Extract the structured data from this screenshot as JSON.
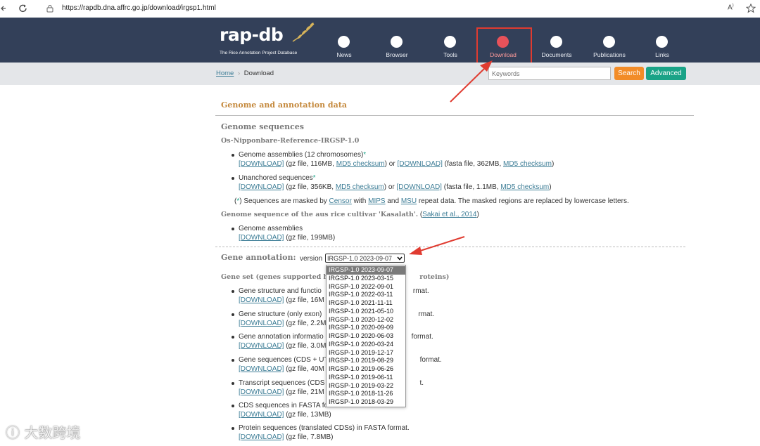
{
  "browser": {
    "url": "https://rapdb.dna.affrc.go.jp/download/irgsp1.html"
  },
  "brand": {
    "logo": "rap-db",
    "tagline": "The Rice Annotation Project Database"
  },
  "nav": [
    {
      "label": "News"
    },
    {
      "label": "Browser"
    },
    {
      "label": "Tools"
    },
    {
      "label": "Download"
    },
    {
      "label": "Documents"
    },
    {
      "label": "Publications"
    },
    {
      "label": "Links"
    }
  ],
  "breadcrumb": {
    "home": "Home",
    "sep": "›",
    "current": "Download"
  },
  "search": {
    "placeholder": "Keywords",
    "search_label": "Search",
    "advanced_label": "Advanced"
  },
  "colors": {
    "header": "#334059",
    "search": "#f28c28",
    "advanced": "#1aa387",
    "highlight": "#e03b30",
    "accent": "#c58a3e"
  },
  "content": {
    "section_title": "Genome and annotation data",
    "genome_seq_title": "Genome sequences",
    "ref_title": "Os-Nipponbare-Reference-IRGSP-1.0",
    "asm_label": "Genome assemblies (12 chromosomes)",
    "asm_star": "*",
    "dl": "[DOWNLOAD]",
    "asm_info1": " (gz file, 116MB, ",
    "md5": "MD5 checksum",
    "asm_or": ") or ",
    "asm_info2": " (fasta file, 362MB, ",
    "close": ")",
    "unanch_label": "Unanchored sequences",
    "unanch_info1": " (gz file, 356KB, ",
    "unanch_info2": " (fasta file, 1.1MB, ",
    "note_pre": "(",
    "note_star": "*",
    "note_mid1": ") Sequences are masked by ",
    "censor": "Censor",
    "note_mid2": " with ",
    "mips": "MIPS",
    "note_mid3": " and ",
    "msu": "MSU",
    "note_end": " repeat data. The masked regions are replaced by lowercase letters.",
    "kasalath_title": "Genome sequence of the aus rice cultivar 'Kasalath'.",
    "kasalath_open": " (",
    "kasalath_ref": "Sakai et al., 2014",
    "kasalath_close": ")",
    "kas_asm": "Genome assemblies",
    "kas_info": " (gz file, 199MB)",
    "gene_annot_title": "Gene annotation:",
    "version_label": "version",
    "version_selected": "IRGSP-1.0 2023-09-07",
    "gene_set_a": "Gene set (genes supported b",
    "gene_set_b": "roteins)",
    "items": [
      {
        "a": "Gene structure and functio",
        "b": "rmat.",
        "c": " (gz file, 16M"
      },
      {
        "a": "Gene structure (only exon)",
        "b": "rmat.",
        "c": " (gz file, 2.2M"
      },
      {
        "a": "Gene annotation informatio",
        "b": "format.",
        "c": " (gz file, 3.0M"
      },
      {
        "a": "Gene sequences (CDS + UT",
        "b": "format.",
        "c": " (gz file, 40M"
      },
      {
        "a": "Transcript sequences (CDS",
        "b": "t.",
        "c": " (gz file, 21M"
      },
      {
        "a": "CDS sequences in FASTA format",
        "b": "",
        "c": " (gz file, 13MB)"
      },
      {
        "a": "Protein sequences (translated CDSs) in FASTA format.",
        "b": "",
        "c": " (gz file, 7.8MB)"
      }
    ],
    "options": [
      "IRGSP-1.0 2023-09-07",
      "IRGSP-1.0 2023-03-15",
      "IRGSP-1.0 2022-09-01",
      "IRGSP-1.0 2022-03-11",
      "IRGSP-1.0 2021-11-11",
      "IRGSP-1.0 2021-05-10",
      "IRGSP-1.0 2020-12-02",
      "IRGSP-1.0 2020-09-09",
      "IRGSP-1.0 2020-06-03",
      "IRGSP-1.0 2020-03-24",
      "IRGSP-1.0 2019-12-17",
      "IRGSP-1.0 2019-08-29",
      "IRGSP-1.0 2019-06-26",
      "IRGSP-1.0 2019-06-11",
      "IRGSP-1.0 2019-03-22",
      "IRGSP-1.0 2018-11-26",
      "IRGSP-1.0 2018-03-29"
    ]
  },
  "watermark": {
    "text": "大数跨境"
  }
}
